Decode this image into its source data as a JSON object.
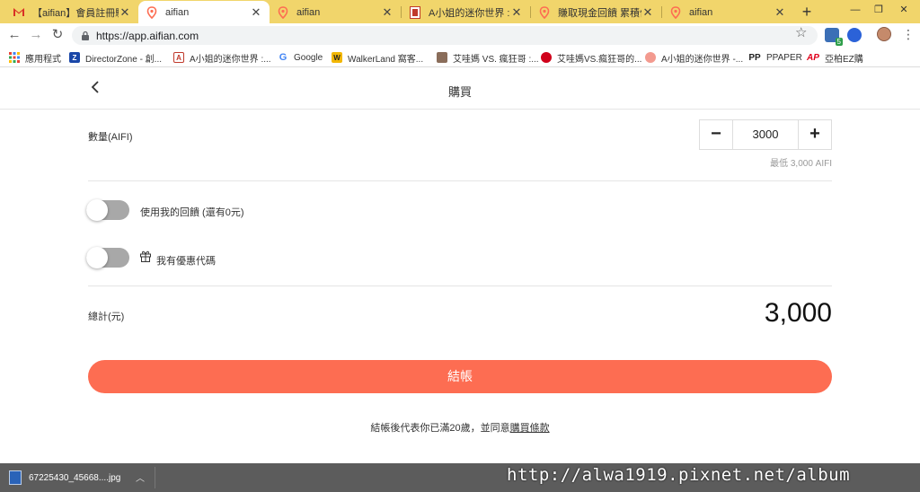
{
  "browser": {
    "tabs": [
      {
        "title": "【aifian】會員註冊驗證",
        "icon": "gmail-icon"
      },
      {
        "title": "aifian",
        "icon": "aifian-pin-icon"
      },
      {
        "title": "aifian",
        "icon": "aifian-pin-icon"
      },
      {
        "title": "A小姐的迷你世界 :: 擺卷",
        "icon": "blog-icon"
      },
      {
        "title": "賺取現金回饋 累積信用",
        "icon": "aifian-pin-icon"
      },
      {
        "title": "aifian",
        "icon": "aifian-pin-icon"
      }
    ],
    "new_tab_label": "+",
    "url": "https://app.aifian.com",
    "bookmarks": [
      {
        "label": "應用程式",
        "icon": "apps-grid-icon"
      },
      {
        "label": "DirectorZone - 創...",
        "icon": "dz-icon"
      },
      {
        "label": "A小姐的迷你世界 :...",
        "icon": "blog-icon"
      },
      {
        "label": "Google",
        "icon": "google-icon"
      },
      {
        "label": "WalkerLand 窩客...",
        "icon": "walkerland-icon"
      },
      {
        "label": "艾哇媽 VS. 瘋狂哥 :...",
        "icon": "photo-icon"
      },
      {
        "label": "艾哇媽VS.瘋狂哥的...",
        "icon": "pin-icon"
      },
      {
        "label": "A小姐的迷你世界 -...",
        "icon": "blog-icon"
      },
      {
        "label": "PPAPER",
        "icon": "ppaper-icon"
      },
      {
        "label": "亞柏EZ購",
        "icon": "ap-icon"
      }
    ],
    "extension_badge": "5",
    "colors": {
      "tab_strip": "#f1d56b",
      "accent": "#fd6d52"
    }
  },
  "page": {
    "title": "購買",
    "quantity_label": "數量(AIFI)",
    "quantity_value": "3000",
    "minus_label": "−",
    "plus_label": "+",
    "min_note": "最低 3,000 AIFI",
    "use_rewards_label": "使用我的回饋 (還有0元)",
    "coupon_label": "我有優惠代碼",
    "total_label": "總計(元)",
    "total_value": "3,000",
    "checkout_label": "結帳",
    "terms_prefix": "結帳後代表你已滿20歲，並同意",
    "terms_link": "購買條款"
  },
  "downloads": {
    "file_name": "67225430_45668....jpg"
  },
  "watermark": "http://alwa1919.pixnet.net/album"
}
